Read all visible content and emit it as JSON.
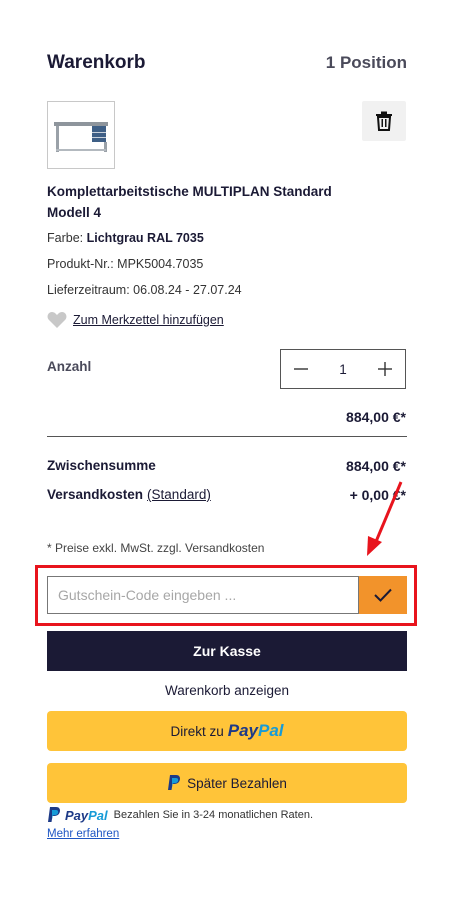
{
  "cart": {
    "title": "Warenkorb",
    "position_count": "1 Position"
  },
  "product": {
    "name": "Komplettarbeitstische MULTIPLAN Standard Modell 4",
    "color_label": "Farbe:",
    "color_value": "Lichtgrau RAL 7035",
    "sku_label": "Produkt-Nr.:",
    "sku_value": "MPK5004.7035",
    "delivery_label": "Lieferzeitraum:",
    "delivery_value": "06.08.24 - 27.07.24",
    "wishlist_label": "Zum Merkzettel hinzufügen",
    "quantity_label": "Anzahl",
    "quantity": "1",
    "price": "884,00 €*"
  },
  "summary": {
    "subtotal_label": "Zwischensumme",
    "subtotal_value": "884,00 €*",
    "shipping_label": "Versandkosten",
    "shipping_link": "(Standard)",
    "shipping_value": "+ 0,00 €*",
    "note": "* Preise exkl. MwSt. zzgl. Versandkosten"
  },
  "coupon": {
    "placeholder": "Gutschein-Code eingeben ..."
  },
  "actions": {
    "checkout": "Zur Kasse",
    "view_cart": "Warenkorb anzeigen",
    "paypal_direct_prefix": "Direkt zu",
    "paypal_word_pay": "Pay",
    "paypal_word_pal": "Pal",
    "paypal_later": "Später Bezahlen"
  },
  "paypal_banner": {
    "text": "Bezahlen Sie in 3-24 monatlichen Raten.",
    "more": "Mehr erfahren"
  },
  "colors": {
    "navy": "#1b1a35",
    "orange": "#f2932b",
    "paypal_yellow": "#ffc439",
    "annotation_red": "#e8141d"
  }
}
